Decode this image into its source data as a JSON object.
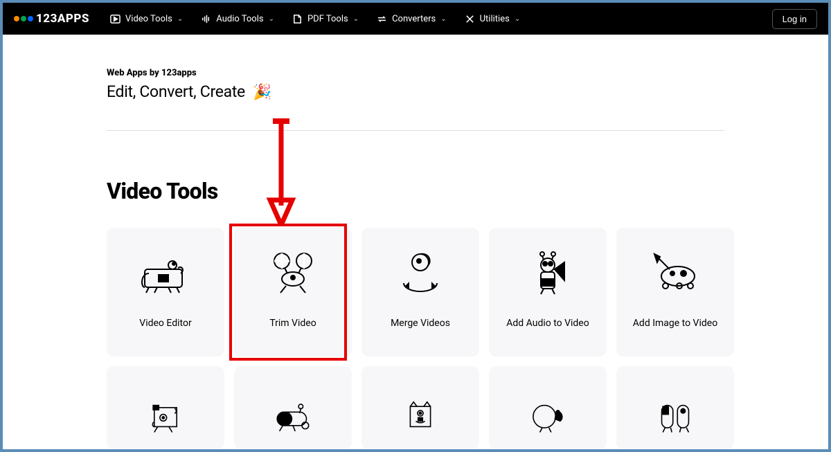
{
  "header": {
    "logo_text": "123APPS",
    "logo_colors": {
      "dot1": "#ff8a00",
      "dot2": "#00a651",
      "dot3": "#0066ff"
    },
    "nav": [
      {
        "icon": "play",
        "label": "Video Tools"
      },
      {
        "icon": "audio",
        "label": "Audio Tools"
      },
      {
        "icon": "pdf",
        "label": "PDF Tools"
      },
      {
        "icon": "convert",
        "label": "Converters"
      },
      {
        "icon": "util",
        "label": "Utilities"
      }
    ],
    "login_label": "Log in"
  },
  "hero": {
    "eyebrow": "Web Apps by 123apps",
    "tagline": "Edit, Convert, Create",
    "emoji": "🎉"
  },
  "section": {
    "title": "Video Tools",
    "cards": [
      {
        "id": "video-editor",
        "label": "Video Editor"
      },
      {
        "id": "trim-video",
        "label": "Trim Video"
      },
      {
        "id": "merge-videos",
        "label": "Merge Videos"
      },
      {
        "id": "add-audio",
        "label": "Add Audio to Video"
      },
      {
        "id": "add-image",
        "label": "Add Image to Video"
      }
    ],
    "cards_row2_count": 5
  },
  "annotation": {
    "highlight_card_index": 1,
    "highlight_color": "#e60000"
  }
}
